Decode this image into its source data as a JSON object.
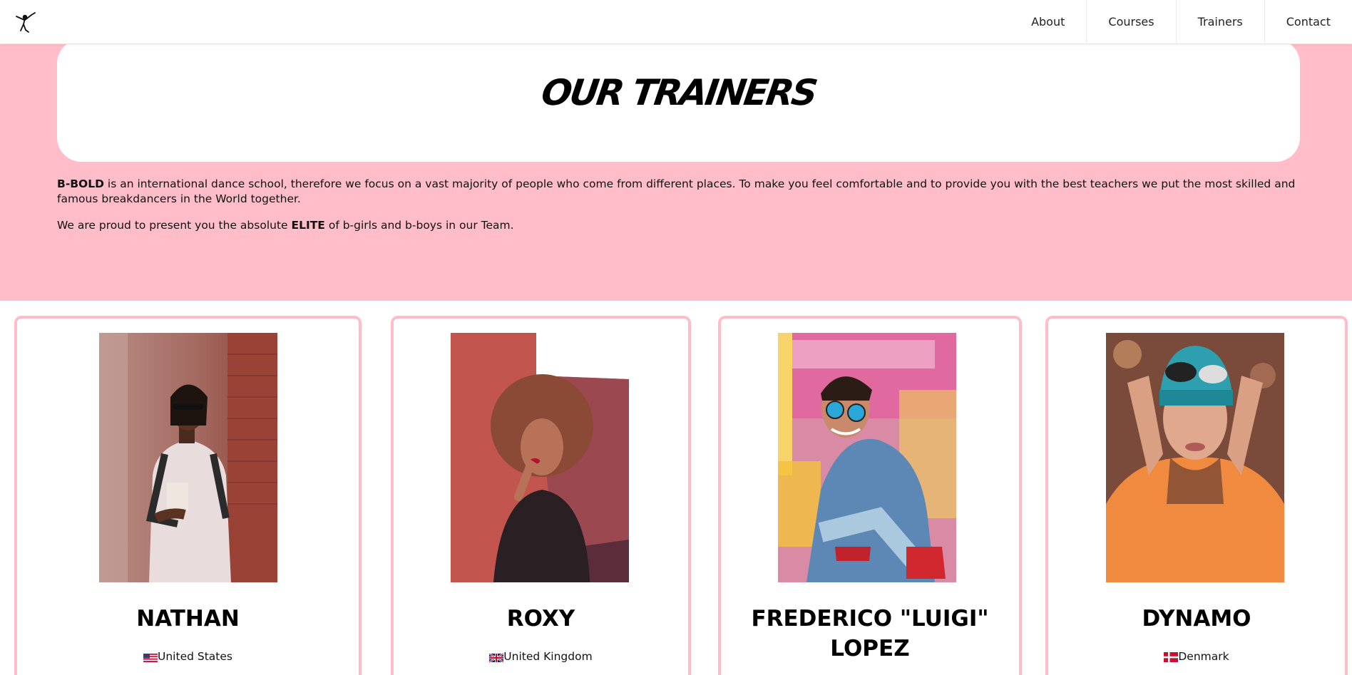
{
  "header": {
    "logo_icon": "breakdancer-logo-icon",
    "nav": [
      {
        "label": "About"
      },
      {
        "label": "Courses"
      },
      {
        "label": "Trainers"
      },
      {
        "label": "Contact"
      }
    ]
  },
  "hero": {
    "title": "OUR TRAINERS",
    "intro_brand": "B-BOLD",
    "intro_rest": " is an international dance school, therefore we focus on a vast majority of people who come from different places. To make you feel comfortable and to provide you with the best teachers we put the most skilled and famous breakdancers in the World together.",
    "line2_pre": "We are proud to present you the absolute ",
    "line2_bold": "ELITE",
    "line2_post": " of b-girls and b-boys in our Team."
  },
  "colors": {
    "accent_pink": "#ffbdc9",
    "white": "#ffffff"
  },
  "trainers": [
    {
      "name": "NATHAN",
      "country": "United States",
      "flag_icon": "us-flag-icon"
    },
    {
      "name": "ROXY",
      "country": "United Kingdom",
      "flag_icon": "uk-flag-icon"
    },
    {
      "name": "FREDERICO \"LUIGI\" LOPEZ",
      "country": "",
      "flag_icon": ""
    },
    {
      "name": "DYNAMO",
      "country": "Denmark",
      "flag_icon": "denmark-flag-icon"
    }
  ]
}
